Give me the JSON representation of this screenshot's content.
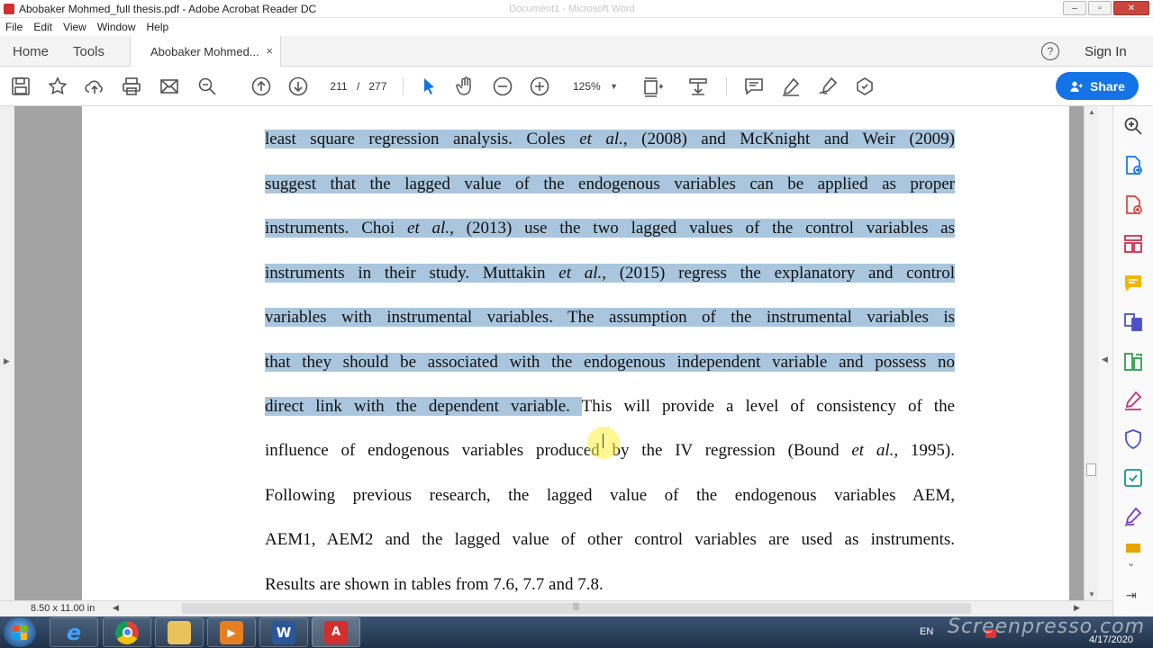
{
  "window": {
    "title": "Abobaker Mohmed_full thesis.pdf - Adobe Acrobat Reader DC",
    "background_title": "Document1 - Microsoft Word",
    "minimize": "–",
    "maximize": "▫",
    "close": "✕"
  },
  "menu": [
    "File",
    "Edit",
    "View",
    "Window",
    "Help"
  ],
  "tabs": {
    "home": "Home",
    "tools": "Tools",
    "document": "Abobaker Mohmed...",
    "close_tab": "×",
    "help": "?",
    "sign_in": "Sign In"
  },
  "toolbar": {
    "current_page": "211",
    "page_separator": "/",
    "total_pages": "277",
    "zoom": "125%",
    "share": "Share"
  },
  "document": {
    "lines": [
      {
        "hl": "least square regression analysis. Coles ",
        "hl_it": "et al.,",
        "hl2": " (2008) and McKnight and Weir (2009)",
        "rest": ""
      },
      {
        "hl": "suggest that the lagged value of the endogenous variables can be applied as proper",
        "rest": ""
      },
      {
        "hl": "instruments. Choi ",
        "hl_it": "et al.,",
        "hl2": " (2013) use the two lagged values of the control variables as",
        "rest": ""
      },
      {
        "hl": "instruments in their study. Muttakin ",
        "hl_it": "et al.,",
        "hl2": " (2015) regress the explanatory and control",
        "rest": ""
      },
      {
        "hl": "variables with instrumental variables. The assumption of the instrumental variables is",
        "rest": ""
      },
      {
        "hl": "that they should be associated with the endogenous independent variable and possess no",
        "rest": ""
      },
      {
        "hl": "direct link with the dependent variable. ",
        "rest": "This will provide a level of consistency of the"
      },
      {
        "pre": "influence of endogenous variables produced by the IV regression (Bound ",
        "it": "et al.,",
        "post": " 1995)."
      },
      {
        "pre": "Following previous research, the lagged value of the endogenous variables AEM,"
      },
      {
        "pre": "AEM1, AEM2 and the lagged value of other control variables are used as instruments."
      },
      {
        "pre": "Results are shown in tables from 7.6, 7.7 and 7.8."
      }
    ]
  },
  "status": {
    "page_size": "8.50 x 11.00 in"
  },
  "taskbar": {
    "language": "EN",
    "watermark": "Screenpresso.com",
    "date": "4/17/2020"
  },
  "colors": {
    "accent": "#1473e6",
    "selection": "#a9c6de",
    "canvas": "#a3a3a3"
  },
  "icons": {
    "toolbar": [
      "save-icon",
      "bookmark-star-icon",
      "upload-cloud-icon",
      "print-icon",
      "email-icon",
      "find-icon",
      "prev-page-icon",
      "next-page-icon",
      "select-arrow-icon",
      "hand-icon",
      "zoom-out-icon",
      "zoom-in-icon",
      "fit-page-icon",
      "scroll-mode-icon",
      "comment-icon",
      "highlight-pen-icon",
      "sign-icon",
      "more-tools-icon"
    ],
    "right_panel": [
      "search-zoom-icon",
      "export-pdf-icon",
      "create-pdf-icon",
      "organize-pages-icon",
      "comment-icon",
      "combine-files-icon",
      "edit-pdf-icon",
      "fill-sign-icon",
      "protect-icon",
      "send-review-icon",
      "sign-pen-icon",
      "more-icon"
    ]
  }
}
